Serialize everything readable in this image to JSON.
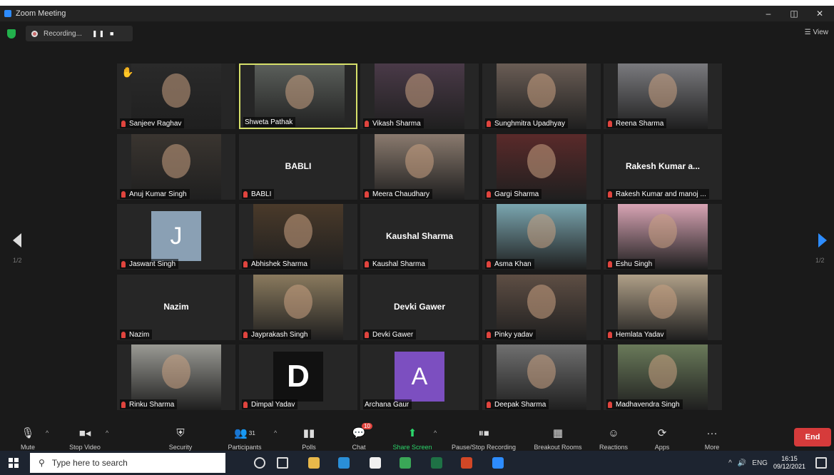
{
  "window": {
    "title": "Zoom Meeting",
    "minimize": "–",
    "restore": "◫",
    "close": "✕"
  },
  "topbar": {
    "recording_label": "Recording...",
    "pause_symbol": "❚❚",
    "stop_symbol": "■",
    "view_label": "View",
    "view_icon": "grid-icon"
  },
  "pager": {
    "left_label": "1/2",
    "right_label": "1/2"
  },
  "participants": [
    {
      "name": "Sanjeev Raghav",
      "kind": "video",
      "muted": true,
      "bg": "#2a2a2a",
      "hand_raised": true
    },
    {
      "name": "Shweta Pathak",
      "kind": "video",
      "muted": false,
      "bg": "#5a5e5a",
      "active": true
    },
    {
      "name": "Vikash Sharma",
      "kind": "video",
      "muted": true,
      "bg": "#4a3a48"
    },
    {
      "name": "Sunghmitra Upadhyay",
      "kind": "video",
      "muted": true,
      "bg": "#6a5d55"
    },
    {
      "name": "Reena Sharma",
      "kind": "video",
      "muted": true,
      "bg": "#7a7a7e"
    },
    {
      "name": "Anuj Kumar Singh",
      "kind": "video",
      "muted": true,
      "bg": "#3a3530"
    },
    {
      "name": "BABLI",
      "kind": "name",
      "muted": true,
      "display": "BABLI"
    },
    {
      "name": "Meera Chaudhary",
      "kind": "video",
      "muted": true,
      "bg": "#8a7a6e"
    },
    {
      "name": "Gargi Sharma",
      "kind": "video",
      "muted": true,
      "bg": "#5a2a2a"
    },
    {
      "name": "Rakesh Kumar and manoj ...",
      "kind": "name",
      "muted": true,
      "display": "Rakesh Kumar a..."
    },
    {
      "name": "Jaswant Singh",
      "kind": "avatar",
      "muted": true,
      "letter": "J",
      "color": "#8aa0b4"
    },
    {
      "name": "Abhishek Sharma",
      "kind": "video",
      "muted": true,
      "bg": "#4a3a2a"
    },
    {
      "name": "Kaushal Sharma",
      "kind": "name",
      "muted": true,
      "display": "Kaushal Sharma"
    },
    {
      "name": "Asma Khan",
      "kind": "video",
      "muted": true,
      "bg": "#7aa6b0"
    },
    {
      "name": "Eshu Singh",
      "kind": "video",
      "muted": true,
      "bg": "#d8a4b4"
    },
    {
      "name": "Nazim",
      "kind": "name",
      "muted": true,
      "display": "Nazim"
    },
    {
      "name": "Jayprakash Singh",
      "kind": "video",
      "muted": true,
      "bg": "#8a7a5e"
    },
    {
      "name": "Devki Gawer",
      "kind": "name",
      "muted": true,
      "display": "Devki Gawer"
    },
    {
      "name": "Pinky yadav",
      "kind": "video",
      "muted": true,
      "bg": "#5e4e44"
    },
    {
      "name": "Hemlata Yadav",
      "kind": "video",
      "muted": true,
      "bg": "#b0a088"
    },
    {
      "name": "Rinku Sharma",
      "kind": "video",
      "muted": true,
      "bg": "#9a9a94"
    },
    {
      "name": "Dimpal Yadav",
      "kind": "avatar",
      "muted": true,
      "letter": "D",
      "color": "#111111"
    },
    {
      "name": "Archana Gaur",
      "kind": "avatar",
      "muted": false,
      "letter": "A",
      "color": "#7c4fc0"
    },
    {
      "name": "Deepak Sharma",
      "kind": "video",
      "muted": true,
      "bg": "#707070"
    },
    {
      "name": "Madhavendra Singh",
      "kind": "video",
      "muted": true,
      "bg": "#6a7a5a"
    }
  ],
  "toolbar": {
    "mute": "Mute",
    "stop_video": "Stop Video",
    "security": "Security",
    "participants": "Participants",
    "participants_count": "31",
    "polls": "Polls",
    "chat": "Chat",
    "chat_badge": "10",
    "share_screen": "Share Screen",
    "pause_stop_recording": "Pause/Stop Recording",
    "breakout_rooms": "Breakout Rooms",
    "reactions": "Reactions",
    "apps": "Apps",
    "more": "More",
    "end": "End"
  },
  "taskbar": {
    "search_placeholder": "Type here to search",
    "lang": "ENG",
    "time": "16:15",
    "date": "09/12/2021",
    "apps": [
      {
        "name": "cortana-icon",
        "color": "#1d2430"
      },
      {
        "name": "task-view-icon",
        "color": "#1d2430"
      },
      {
        "name": "file-explorer-icon",
        "color": "#e8b84a"
      },
      {
        "name": "edge-icon",
        "color": "#2a8fd8"
      },
      {
        "name": "notepad-icon",
        "color": "#f0f0f0"
      },
      {
        "name": "chrome-icon",
        "color": "#3aa757"
      },
      {
        "name": "excel-icon",
        "color": "#1e7145"
      },
      {
        "name": "powerpoint-icon",
        "color": "#d24726"
      },
      {
        "name": "zoom-icon",
        "color": "#2d8cff"
      }
    ]
  }
}
